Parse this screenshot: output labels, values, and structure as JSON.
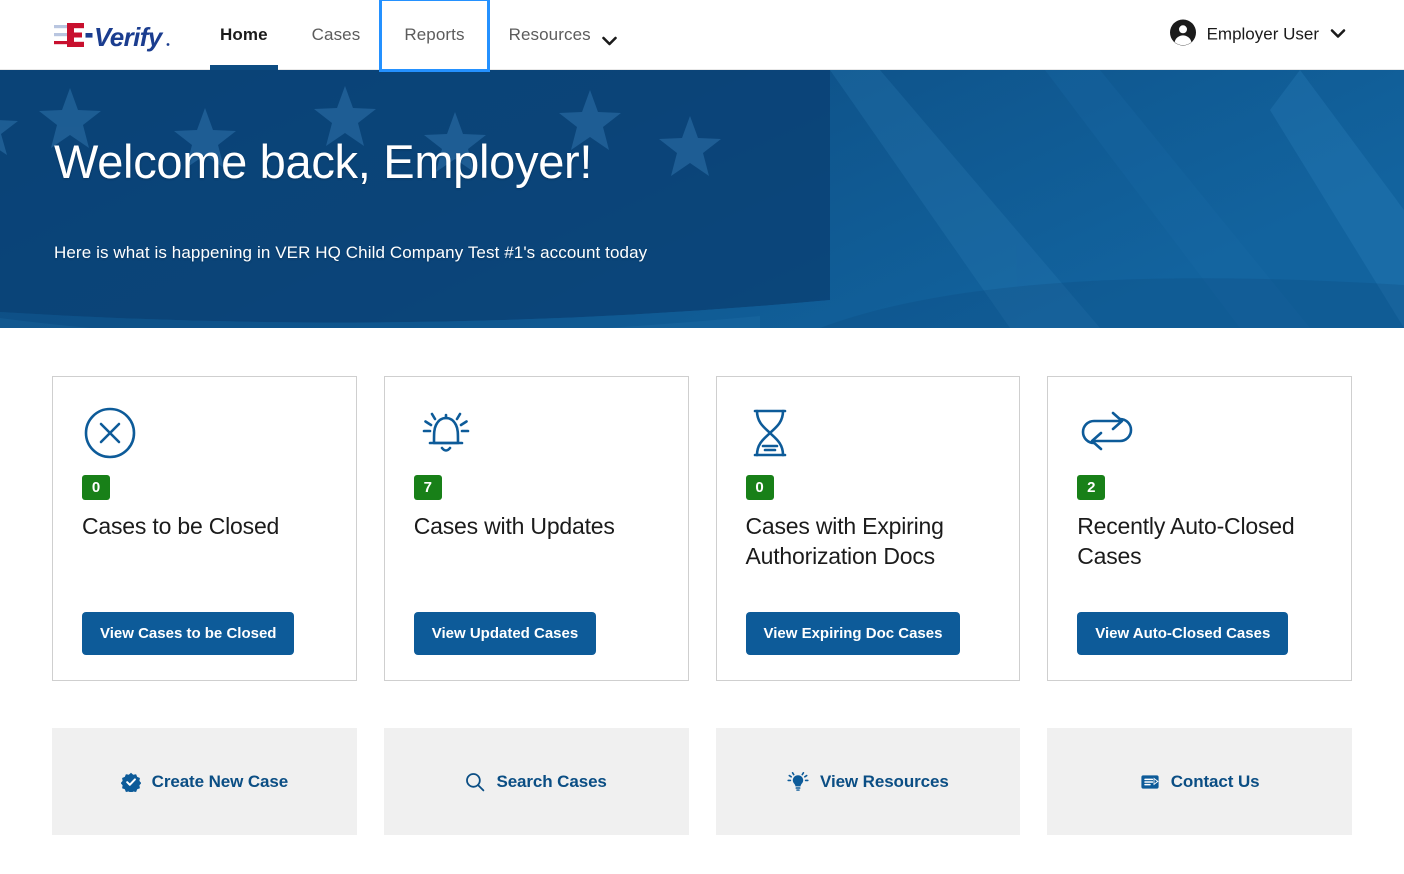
{
  "header": {
    "logo": {
      "e": "E",
      "dash": "-",
      "verify": "Verify",
      "name": "e-verify-logo"
    },
    "nav": [
      {
        "label": "Home",
        "state": "active"
      },
      {
        "label": "Cases",
        "state": "default"
      },
      {
        "label": "Reports",
        "state": "focused"
      },
      {
        "label": "Resources",
        "state": "dropdown"
      }
    ],
    "user": {
      "name": "Employer User",
      "avatar_icon": "user-circle-icon",
      "caret_icon": "chevron-down-icon"
    }
  },
  "hero": {
    "title": "Welcome back, Employer!",
    "subtitle": "Here is what is happening in VER HQ Child Company Test #1's account today"
  },
  "cards": [
    {
      "icon": "circle-x-icon",
      "count": "0",
      "title": "Cases to be Closed",
      "button": "View Cases to be Closed"
    },
    {
      "icon": "bell-ringing-icon",
      "count": "7",
      "title": "Cases with Updates",
      "button": "View Updated Cases"
    },
    {
      "icon": "hourglass-icon",
      "count": "0",
      "title": "Cases with Expiring Authorization Docs",
      "button": "View Expiring Doc Cases"
    },
    {
      "icon": "repeat-arrows-icon",
      "count": "2",
      "title": "Recently Auto-Closed Cases",
      "button": "View Auto-Closed Cases"
    }
  ],
  "quick_actions": [
    {
      "icon": "verified-badge-icon",
      "label": "Create New Case"
    },
    {
      "icon": "search-icon",
      "label": "Search Cases"
    },
    {
      "icon": "lightbulb-icon",
      "label": "View Resources"
    },
    {
      "icon": "mail-envelope-icon",
      "label": "Contact Us"
    }
  ],
  "colors": {
    "brand_blue": "#0d5b99",
    "nav_underline": "#0d4c82",
    "focus_ring": "#2491ff",
    "badge_green": "#188018",
    "hero_blue": "#0d4c82",
    "tile_gray": "#f0f0f0",
    "logo_red": "#c8102e",
    "logo_blue": "#1b3d8f"
  }
}
